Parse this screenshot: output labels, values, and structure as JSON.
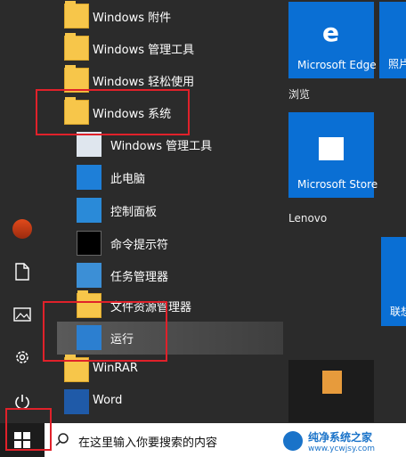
{
  "apps": [
    {
      "label": "Windows 附件",
      "expanded": false
    },
    {
      "label": "Windows 管理工具",
      "expanded": false
    },
    {
      "label": "Windows 轻松使用",
      "expanded": false
    },
    {
      "label": "Windows 系统",
      "expanded": true
    }
  ],
  "subitems": [
    {
      "label": "Windows 管理工具",
      "icon": "admin-tools-icon"
    },
    {
      "label": "此电脑",
      "icon": "this-pc-icon"
    },
    {
      "label": "控制面板",
      "icon": "control-panel-icon"
    },
    {
      "label": "命令提示符",
      "icon": "cmd-icon"
    },
    {
      "label": "任务管理器",
      "icon": "task-manager-icon"
    },
    {
      "label": "文件资源管理器",
      "icon": "file-explorer-icon"
    },
    {
      "label": "运行",
      "icon": "run-icon"
    }
  ],
  "more_apps": [
    {
      "label": "WinRAR"
    },
    {
      "label": "Word"
    }
  ],
  "tiles": {
    "edge_label": "Microsoft Edge",
    "photo_label": "照片",
    "browse_group": "浏览",
    "store_label": "Microsoft Store",
    "lenovo_group": "Lenovo",
    "connect_label": "联想"
  },
  "search": {
    "placeholder": "在这里输入你要搜索的内容"
  },
  "watermark": {
    "brand": "纯净系统之家",
    "url": "www.ycwjsy.com"
  },
  "colors": {
    "tile_blue": "#0a6fd4",
    "folder_yellow": "#f7c64a",
    "highlight_red": "#e0212a"
  }
}
